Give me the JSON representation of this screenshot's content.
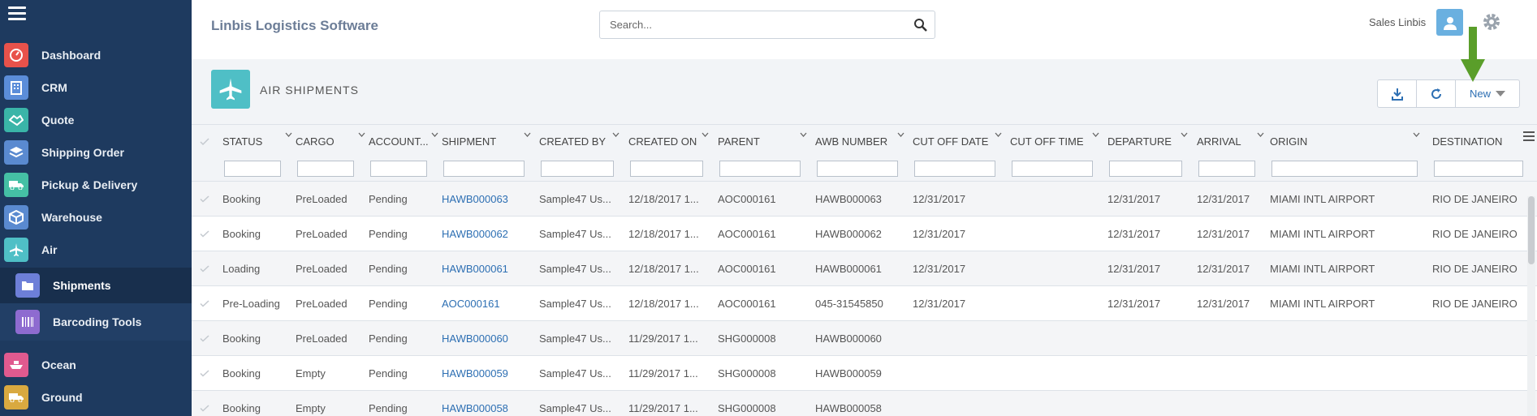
{
  "app": {
    "title": "Linbis Logistics Software"
  },
  "search": {
    "placeholder": "Search..."
  },
  "user": {
    "name": "Sales Linbis"
  },
  "sidebar": {
    "items": [
      {
        "label": "Dashboard",
        "icon": "dashboard-icon",
        "color": "#e8524b"
      },
      {
        "label": "CRM",
        "icon": "building-icon",
        "color": "#5b8dd9"
      },
      {
        "label": "Quote",
        "icon": "handshake-icon",
        "color": "#3ab5a8"
      },
      {
        "label": "Shipping Order",
        "icon": "layers-icon",
        "color": "#5a8ad0"
      },
      {
        "label": "Pickup & Delivery",
        "icon": "truck-icon",
        "color": "#45c0a5"
      },
      {
        "label": "Warehouse",
        "icon": "box-icon",
        "color": "#5a8ad0"
      },
      {
        "label": "Air",
        "icon": "plane-icon",
        "color": "#4fbfc6"
      },
      {
        "label": "Shipments",
        "icon": "folder-icon",
        "color": "#6d7fd8",
        "active": true
      },
      {
        "label": "Barcoding Tools",
        "icon": "barcode-icon",
        "color": "#8e6bd0"
      },
      {
        "label": "Ocean",
        "icon": "ship-icon",
        "color": "#e05a8f"
      },
      {
        "label": "Ground",
        "icon": "ground-truck-icon",
        "color": "#d9a940"
      }
    ]
  },
  "page": {
    "title": "AIR SHIPMENTS"
  },
  "toolbar": {
    "new_label": "New"
  },
  "grid": {
    "columns": [
      "STATUS",
      "CARGO",
      "ACCOUNT...",
      "SHIPMENT",
      "CREATED BY",
      "CREATED ON",
      "PARENT",
      "AWB NUMBER",
      "CUT OFF DATE",
      "CUT OFF TIME",
      "DEPARTURE",
      "ARRIVAL",
      "ORIGIN",
      "DESTINATION"
    ],
    "rows": [
      [
        "Booking",
        "PreLoaded",
        "Pending",
        "HAWB000063",
        "Sample47 Us...",
        "12/18/2017 1...",
        "AOC000161",
        "HAWB000063",
        "12/31/2017",
        "",
        "12/31/2017",
        "12/31/2017",
        "MIAMI INTL AIRPORT",
        "RIO DE JANEIRO"
      ],
      [
        "Booking",
        "PreLoaded",
        "Pending",
        "HAWB000062",
        "Sample47 Us...",
        "12/18/2017 1...",
        "AOC000161",
        "HAWB000062",
        "12/31/2017",
        "",
        "12/31/2017",
        "12/31/2017",
        "MIAMI INTL AIRPORT",
        "RIO DE JANEIRO"
      ],
      [
        "Loading",
        "PreLoaded",
        "Pending",
        "HAWB000061",
        "Sample47 Us...",
        "12/18/2017 1...",
        "AOC000161",
        "HAWB000061",
        "12/31/2017",
        "",
        "12/31/2017",
        "12/31/2017",
        "MIAMI INTL AIRPORT",
        "RIO DE JANEIRO"
      ],
      [
        "Pre-Loading",
        "PreLoaded",
        "Pending",
        "AOC000161",
        "Sample47 Us...",
        "12/18/2017 1...",
        "AOC000161",
        "045-31545850",
        "12/31/2017",
        "",
        "12/31/2017",
        "12/31/2017",
        "MIAMI INTL AIRPORT",
        "RIO DE JANEIRO"
      ],
      [
        "Booking",
        "PreLoaded",
        "Pending",
        "HAWB000060",
        "Sample47 Us...",
        "11/29/2017 1...",
        "SHG000008",
        "HAWB000060",
        "",
        "",
        "",
        "",
        "",
        ""
      ],
      [
        "Booking",
        "Empty",
        "Pending",
        "HAWB000059",
        "Sample47 Us...",
        "11/29/2017 1...",
        "SHG000008",
        "HAWB000059",
        "",
        "",
        "",
        "",
        "",
        ""
      ],
      [
        "Booking",
        "Empty",
        "Pending",
        "HAWB000058",
        "Sample47 Us...",
        "11/29/2017 1...",
        "SHG000008",
        "HAWB000058",
        "",
        "",
        "",
        "",
        "",
        ""
      ]
    ]
  },
  "colors": {
    "sidebar": "#1e3a5f",
    "link": "#2d6fb3",
    "accent": "#4fbfc6",
    "arrow": "#5a9e2a"
  }
}
